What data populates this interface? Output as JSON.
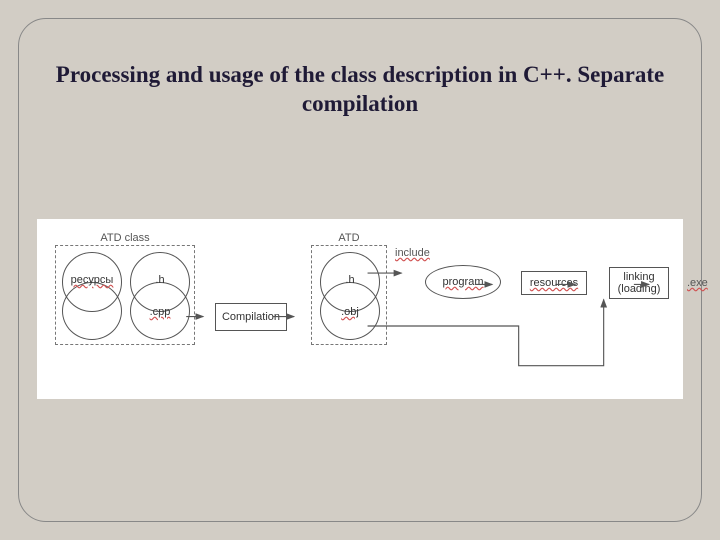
{
  "title": "Processing and usage of the class description in C++. Separate compilation",
  "diagram": {
    "atd_class_label": "ATD class",
    "atd_label": "ATD",
    "pair1_top": "ресурсы",
    "pair1_bottom": "",
    "pair2_top": ".h",
    "pair2_bottom": ".cpp",
    "pair3_top": ".h",
    "pair3_bottom": ".obj",
    "compilation": "Compilation",
    "include_label": "include",
    "program": "program",
    "resources": "resources",
    "linking_top": "linking",
    "linking_bottom": "(loading)",
    "exe": ".exe"
  }
}
